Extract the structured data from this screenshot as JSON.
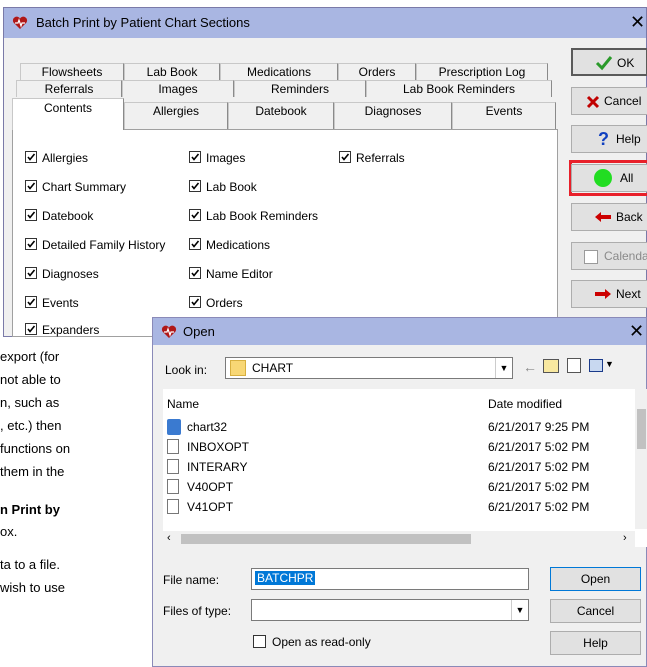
{
  "doc_text": {
    "line1": "export  (for",
    "line2": "not  able  to",
    "line3": "n,  such  as",
    "line4": ",  etc.)  then",
    "line5": "functions on",
    "line6": "them in the",
    "line7": "n  Print  by",
    "line8": "ox.",
    "line9": "ta to a file.",
    "line10": "wish to use"
  },
  "batch_window": {
    "title": "Batch Print by Patient Chart Sections",
    "close_glyph": "✕",
    "tabs_row1": [
      "Flowsheets",
      "Lab Book",
      "Medications",
      "Orders",
      "Prescription Log"
    ],
    "tabs_row2": [
      "Referrals",
      "Images",
      "Reminders",
      "Lab Book Reminders"
    ],
    "tabs_row3": [
      "Contents",
      "Allergies",
      "Datebook",
      "Diagnoses",
      "Events"
    ],
    "col1": [
      "Allergies",
      "Chart Summary",
      "Datebook",
      "Detailed Family History",
      "Diagnoses",
      "Events",
      "Expanders"
    ],
    "col2": [
      "Images",
      "Lab Book",
      "Lab Book Reminders",
      "Medications",
      "Name Editor",
      "Orders"
    ],
    "col3": [
      "Referrals"
    ],
    "buttons": {
      "ok": "OK",
      "cancel": "Cancel",
      "help": "Help",
      "all": "All",
      "back": "Back",
      "calendar": "Calenda",
      "next": "Next"
    },
    "colors": {
      "highlight_border": "#e8202a",
      "all_dot": "#22dd22",
      "cancel_x": "#c00000",
      "arrow": "#cc0000",
      "help_q": "#1040c0",
      "ok_check": "#2a9a2a"
    }
  },
  "open_dialog": {
    "title": "Open",
    "close_glyph": "✕",
    "look_in_label": "Look in:",
    "look_in_value": "CHART",
    "col_name": "Name",
    "col_date": "Date modified",
    "files": [
      {
        "name": "chart32",
        "date": "6/21/2017 9:25 PM",
        "icon": "pdf-file-icon"
      },
      {
        "name": "INBOXOPT",
        "date": "6/21/2017 5:02 PM",
        "icon": "file-icon"
      },
      {
        "name": "INTERARY",
        "date": "6/21/2017 5:02 PM",
        "icon": "file-icon"
      },
      {
        "name": "V40OPT",
        "date": "6/21/2017 5:02 PM",
        "icon": "file-icon"
      },
      {
        "name": "V41OPT",
        "date": "6/21/2017 5:02 PM",
        "icon": "file-icon"
      }
    ],
    "file_name_label": "File name:",
    "file_name_value": "BATCHPR",
    "files_of_type_label": "Files of type:",
    "files_of_type_value": "",
    "read_only_label": "Open as read-only",
    "open_button": "Open",
    "cancel_button": "Cancel",
    "help_button": "Help"
  }
}
